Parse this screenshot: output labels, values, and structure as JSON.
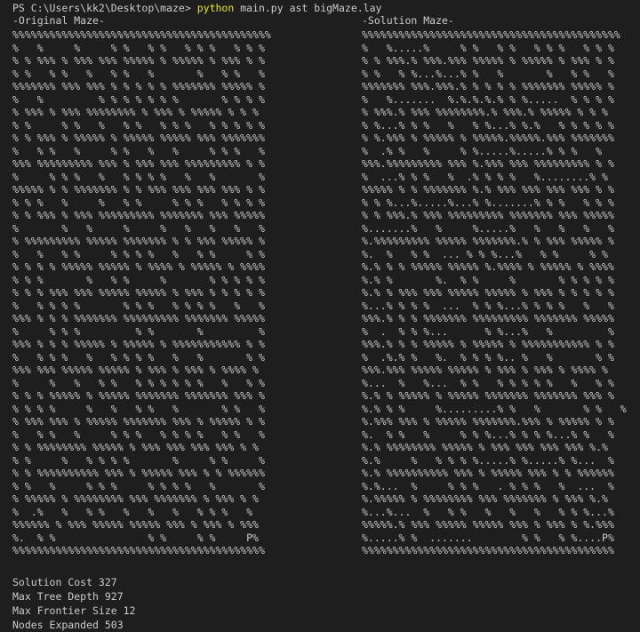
{
  "terminal": {
    "prompt": "PS C:\\Users\\kk2\\Desktop\\maze> ",
    "command": "python",
    "args": " main.py ast bigMaze.lay"
  },
  "headers": {
    "left": "-Original Maze-",
    "right": "-Solution Maze-"
  },
  "maze_original": "%%%%%%%%%%%%%%%%%%%%%%%%%%%%%%%%%%%%%%%%%%\n%   %     %     % %   % %   % % %   % % %\n% % %%% % %%% %%% %%%%% % %%%%% % %%% % %\n% %   % %   %   % %   %       %   % %   %\n%%%%%%% %%% %%% % % % % % %%%%%%% %%%%% %\n%   %         % % % % % % %       % % % %\n% %%% % %%% %%%%%%%% % %%% % %%%%% % % %\n% %     % %   %   % %   % % %   % % % % %\n% % %%% % %%%%% % %%%%% %%%%% %%% %%%%%%%\n%   % %   %     % %   %   %     % % %   %\n%%% %%%%%%%%% %%% % %%% %%% %%%%%%%%% % %\n%     % % %   %   % % % %   %   %       %\n%%%%% % % %%%%%%% % % %%% %%% %%% %%% % %\n% % %   %     %   % %     % % %   % % % %\n% % %%% % %%% %%%%%%%%% %%%%%%% %%% %%%%%\n%       %   %     %     %   %   %   %   %\n% %%%%%%%%% %%%%% %%%%%%% % % %%% %%%%% %\n%   %   % %     % % % %   %   % %     % %\n% % % % %%%%% %%%%% % %%%% % %%%%% % %%%%\n% % %       %   % %     %       % % % % %\n% % % %%% %%% %%%%% %%%%% % %%% % % % % %\n%   % % % %       % % %   % % % %   %   %\n%%% % % % %%%%%%% %%%%%%%%% %%%%%%% %%%%%\n%     % % %         % %       %         %\n%%% % % % %%%%% % %%%%% % %%%%%%%%%%% % %\n%   % % %   %   % % % %   %   %       % %\n%%% %%% %%%%% %%%%% % %%% % %%% % %%%% %\n%     %   %   % %   % % % % % %   %   % %\n% % % %%%%% % %%%%% %%%%%%% %%%%%%% %%% %\n% % % %     %   %   % %   %       % %   %\n% %%% %%% % %%%%% %%%%%%% %%% % %%%%% % %\n%   % %   %     % % %   % % % %   % %   %\n% % %%%%%%%% %%%%% % %%% %%% %%% %%% % %\n% %     %   % % % %       %     % %     %\n% % %%%%%%%%%% %%% % %%%%% %%% % % %%%%%%\n% %   %     % % %     % % % %   %       %\n% %%%%% % %%%%%%%% %%% %%%%%%% % %%% % %\n%  .%   %   % %   %   %   %   % % %   %\n%%%%%% % %%% %%%%% %%%%% %%% % %%% % %%%\n%.  % %               % %     % %     P%\n%%%%%%%%%%%%%%%%%%%%%%%%%%%%%%%%%%%%%%%%%",
  "maze_solution": "%%%%%%%%%%%%%%%%%%%%%%%%%%%%%%%%%%%%%%%%%%\n%   %.....%     % %   % %   % % %   % % %\n% % %%%.% %%%.%%% %%%%% % %%%%% % %%% % %\n% %   % %...%...% %   %       %   % %   %\n%%%%%%% %%%.%%%.% % % % % %%%%%%% %%%%% %\n%   %.......  %.%.%.%.% % %.....  % % % %\n% %%%.% %%% %%%%%%%%.% %%%.% %%%%% % % %\n% %...% % %   %   % %...% %.%   % % % % %\n% %.%%% % %%%%% % %%%%%.%%%%%.%%% %%%%%%%\n%  .% %   %     % %.....%.....% % %   %\n%%%.%%%%%%%%% %%% %.%%% %%% %%%%%%%%% % %\n%  ...% % %   %  .% % % %   %........% %\n%%%%% % % %%%%%%% %.% %%% %%% %%% %%% % %\n% % %...%.....%...% %.......% % %   % % %\n% % %%%.% %%% %%%%%%%%% %%%%%%% %%% %%%%%\n%.......%   %     %.....%   %   %   %   %\n%.%%%%%%%%% %%%%% %%%%%%%.% % %%% %%%%% %\n%.  %   % %  ... % % %...%   % %     % %\n%.% % % %%%%% %%%%% %.%%%% % %%%%% % %%%%\n%.% %       %.  % %     %       % % % % %\n%.% % %%% %%% %%%%% %%%%% % %%% % % % % %\n%...% % % %  ...  % % %...% % % %   %   %\n%%%.% % % %%%%%%% %%%%%%%%% %%%%%%% %%%%%\n%  .  % % %...      % %...%   %         %\n%%%.% % % %%%%% % %%%%% % %%%%%%%%%%% % %\n%  .%.% %   %.  % % % %.. %   %       % %\n%%%.%%% %%%%% %%%%% % %%% % %%% % %%%% %\n%...  %   %...  % %   % % % % %   %   % %\n%.% % %%%%% % %%%%% %%%%%%% %%%%%%% %%% %\n%.% % %     %.........% %   %       % %   %\n%.%%% %%% % %%%%% %%%%%%%.%%% % %%%%% % %\n%.  % %   %     % % %...% % % %...% %   %\n%.% %%%%%%%% %%%%% % %%% %%% %%% %%% %.%\n%.%     %   % % % %.....% %.....% %...  %\n%.% %%%%%%%%%% %%% % %%%%% %%% % % %%%%%%\n%.%...  %     % % %   . % % %   %  ...  %\n%.%%%%% % %%%%%%%% %%% %%%%%%% % %%% %.%\n%...%...  %   % %   %   %   %   % % %...%\n%%%%%.% %%% %%%%% %%%%% %%% % %%% % %.%%%\n%.....% %  .......        % %   % %....P%\n%%%%%%%%%%%%%%%%%%%%%%%%%%%%%%%%%%%%%%%%%",
  "stats": {
    "solution_cost": "Solution Cost 327",
    "max_depth": "Max Tree Depth 927",
    "max_frontier": "Max Frontier Size 12",
    "nodes_expanded": "Nodes Expanded 503"
  },
  "colors": {
    "background": "#1e1e1e",
    "text": "#cccccc",
    "command": "#e5e510"
  }
}
